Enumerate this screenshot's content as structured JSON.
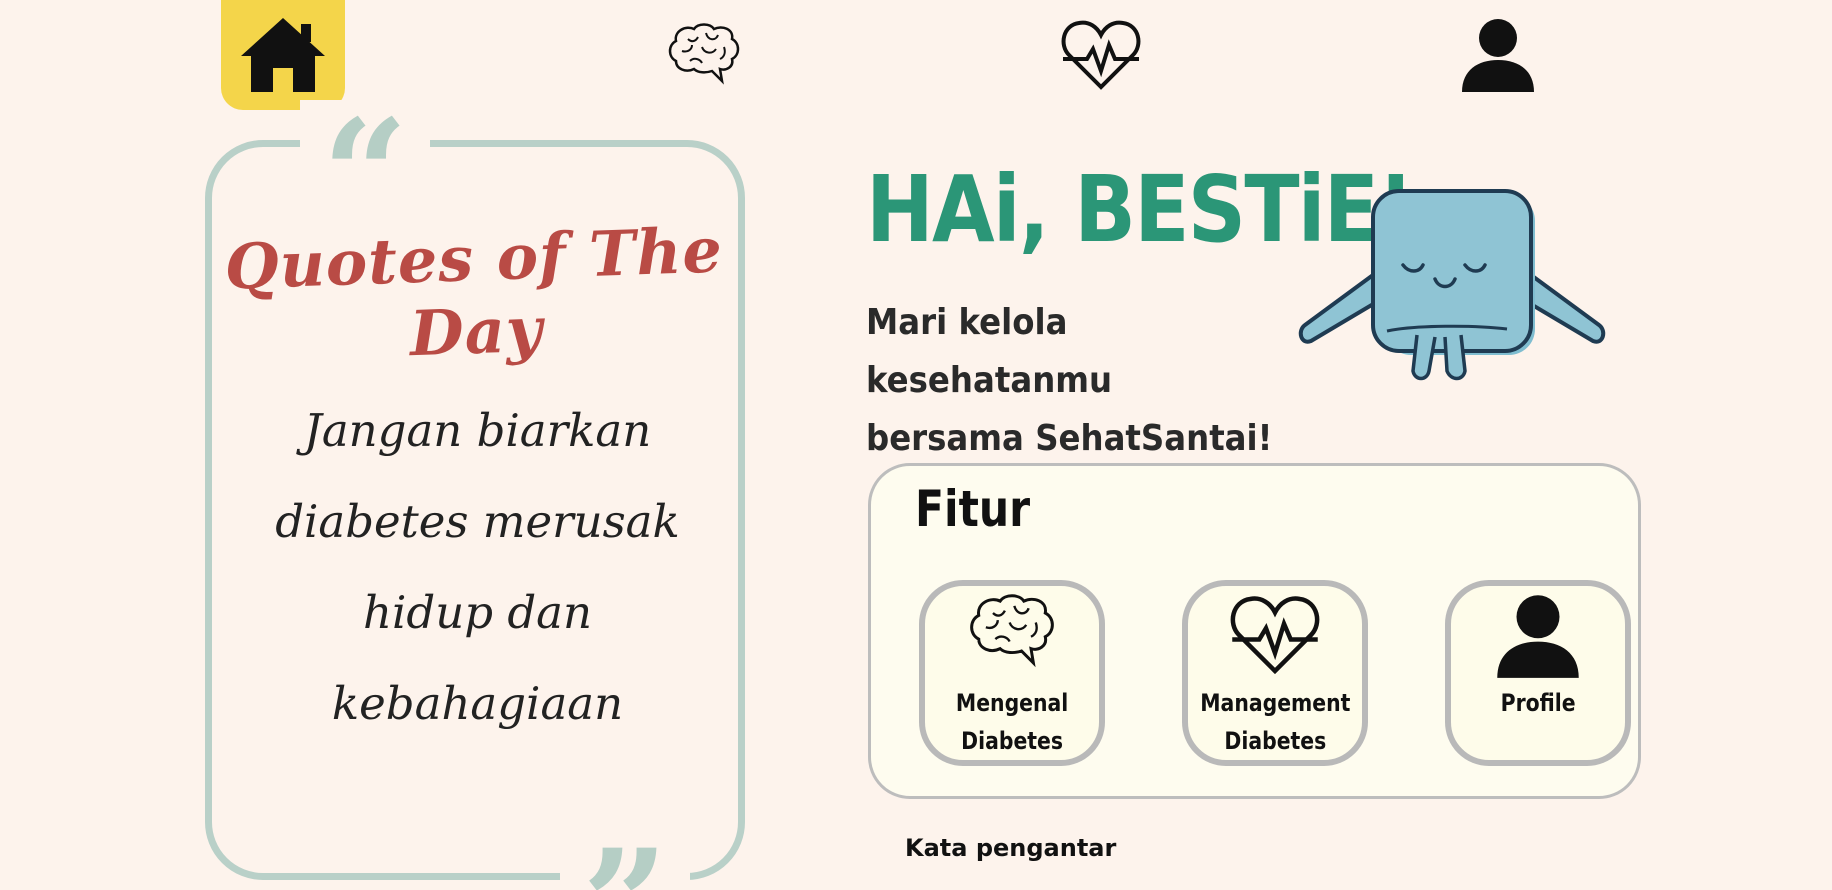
{
  "nav": {
    "items": [
      {
        "name": "home",
        "icon": "home-icon",
        "active": true
      },
      {
        "name": "brain",
        "icon": "brain-icon",
        "active": false
      },
      {
        "name": "heart",
        "icon": "heart-pulse-icon",
        "active": false
      },
      {
        "name": "profile",
        "icon": "user-icon",
        "active": false
      }
    ],
    "active_color": "#f4d54a"
  },
  "quote": {
    "title": "Quotes of The Day",
    "lines": [
      "Jangan biarkan",
      "diabetes merusak",
      "hidup dan",
      "kebahagiaan"
    ]
  },
  "greeting": {
    "title": "HAi, BESTiE!",
    "subtitle_line1": "Mari kelola kesehatanmu",
    "subtitle_line2": "bersama SehatSantai!"
  },
  "features": {
    "title": "Fitur",
    "items": [
      {
        "icon": "brain-icon",
        "line1": "Mengenal",
        "line2": "Diabetes"
      },
      {
        "icon": "heart-pulse-icon",
        "line1": "Management",
        "line2": "Diabetes"
      },
      {
        "icon": "user-icon",
        "line1": "Profile",
        "line2": ""
      }
    ]
  },
  "intro": {
    "label": "Kata pengantar"
  },
  "colors": {
    "background": "#fdf3ec",
    "accent_green": "#2b9677",
    "quote_title": "#b94b45",
    "quote_border": "#b9d0c8",
    "feature_card_bg": "#fefcea"
  }
}
